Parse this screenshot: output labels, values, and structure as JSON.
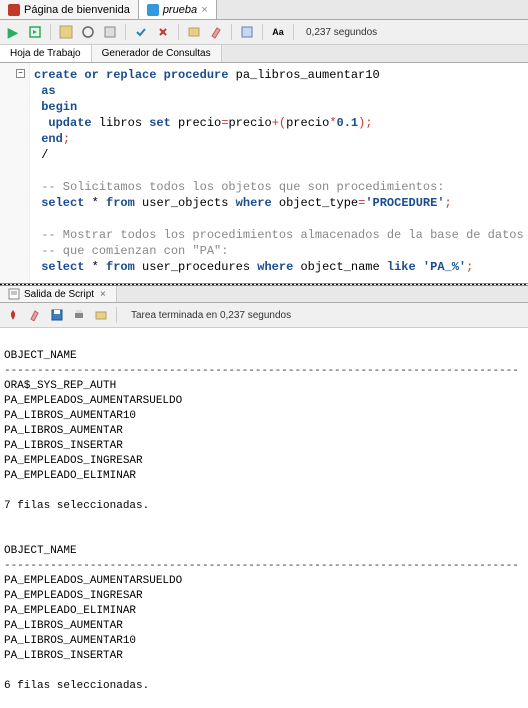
{
  "tabs": {
    "welcome": "Página de bienvenida",
    "file": "prueba"
  },
  "toolbar": {
    "status": "0,237 segundos"
  },
  "subtabs": {
    "worksheet": "Hoja de Trabajo",
    "query_builder": "Generador de Consultas"
  },
  "code": {
    "l1a": "create or replace procedure",
    "l1b": " pa_libros_aumentar10",
    "l2": "as",
    "l3": "begin",
    "l4a": "update",
    "l4b": " libros ",
    "l4c": "set",
    "l4d": " precio",
    "l4e": "=",
    "l4f": "precio",
    "l4g": "+(",
    "l4h": "precio",
    "l4i": "*",
    "l4j": "0.1",
    "l4k": ");",
    "l5": "end",
    "l5b": ";",
    "l6": "/",
    "l8": "-- Solicitamos todos los objetos que son procedimientos:",
    "l9a": "select",
    "l9b": " *",
    "l9c": "from",
    "l9d": " user_objects ",
    "l9e": "where",
    "l9f": " object_type",
    "l9g": "=",
    "l9h": "'PROCEDURE'",
    "l9i": ";",
    "l11": "-- Mostrar todos los procedimientos almacenados de la base de datos actual",
    "l12": "-- que comienzan con \"PA\":",
    "l13a": "select",
    "l13b": " * ",
    "l13c": "from",
    "l13d": " user_procedures ",
    "l13e": "where",
    "l13f": " object_name ",
    "l13g": "like",
    "l13h": " ",
    "l13i": "'PA_%'",
    "l13j": ";"
  },
  "output_tab": {
    "label": "Salida de Script"
  },
  "output_toolbar": {
    "status": "Tarea terminada en 0,237 segundos"
  },
  "output": {
    "header1": "OBJECT_NAME",
    "sep": "------------------------------------------------------------------------------",
    "r1_1": "ORA$_SYS_REP_AUTH",
    "r1_2": "PA_EMPLEADOS_AUMENTARSUELDO",
    "r1_3": "PA_LIBROS_AUMENTAR10",
    "r1_4": "PA_LIBROS_AUMENTAR",
    "r1_5": "PA_LIBROS_INSERTAR",
    "r1_6": "PA_EMPLEADOS_INGRESAR",
    "r1_7": "PA_EMPLEADO_ELIMINAR",
    "count1": "7 filas seleccionadas.",
    "header2": "OBJECT_NAME",
    "r2_1": "PA_EMPLEADOS_AUMENTARSUELDO",
    "r2_2": "PA_EMPLEADOS_INGRESAR",
    "r2_3": "PA_EMPLEADO_ELIMINAR",
    "r2_4": "PA_LIBROS_AUMENTAR",
    "r2_5": "PA_LIBROS_AUMENTAR10",
    "r2_6": "PA_LIBROS_INSERTAR",
    "count2": "6 filas seleccionadas."
  }
}
